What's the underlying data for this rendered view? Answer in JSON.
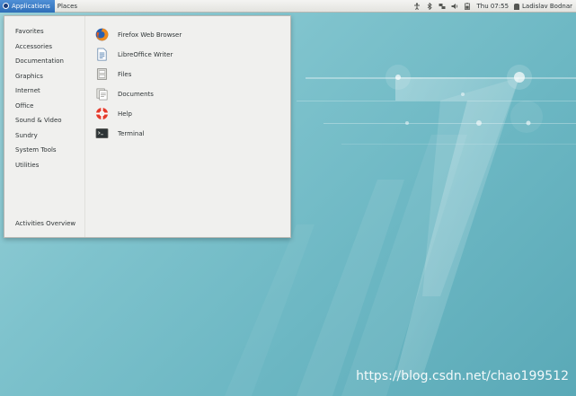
{
  "topbar": {
    "applications_label": "Applications",
    "places_label": "Places",
    "clock": "Thu 07:55",
    "user_name": "Ladislav Bodnar"
  },
  "menu": {
    "categories": [
      "Favorites",
      "Accessories",
      "Documentation",
      "Graphics",
      "Internet",
      "Office",
      "Sound & Video",
      "Sundry",
      "System Tools",
      "Utilities"
    ],
    "activities_overview": "Activities Overview",
    "apps": [
      {
        "label": "Firefox Web Browser",
        "icon": "firefox-icon"
      },
      {
        "label": "LibreOffice Writer",
        "icon": "libreoffice-writer-icon"
      },
      {
        "label": "Files",
        "icon": "files-icon"
      },
      {
        "label": "Documents",
        "icon": "documents-icon"
      },
      {
        "label": "Help",
        "icon": "help-icon"
      },
      {
        "label": "Terminal",
        "icon": "terminal-icon"
      }
    ]
  },
  "tray_icons": [
    "accessibility-icon",
    "bluetooth-icon",
    "network-icon",
    "volume-icon",
    "battery-icon"
  ],
  "watermark": "https://blog.csdn.net/chao199512",
  "colors": {
    "active_menu": "#3a7cc6",
    "menu_background": "#f0f0ee",
    "wallpaper": "#7fc3cd"
  }
}
